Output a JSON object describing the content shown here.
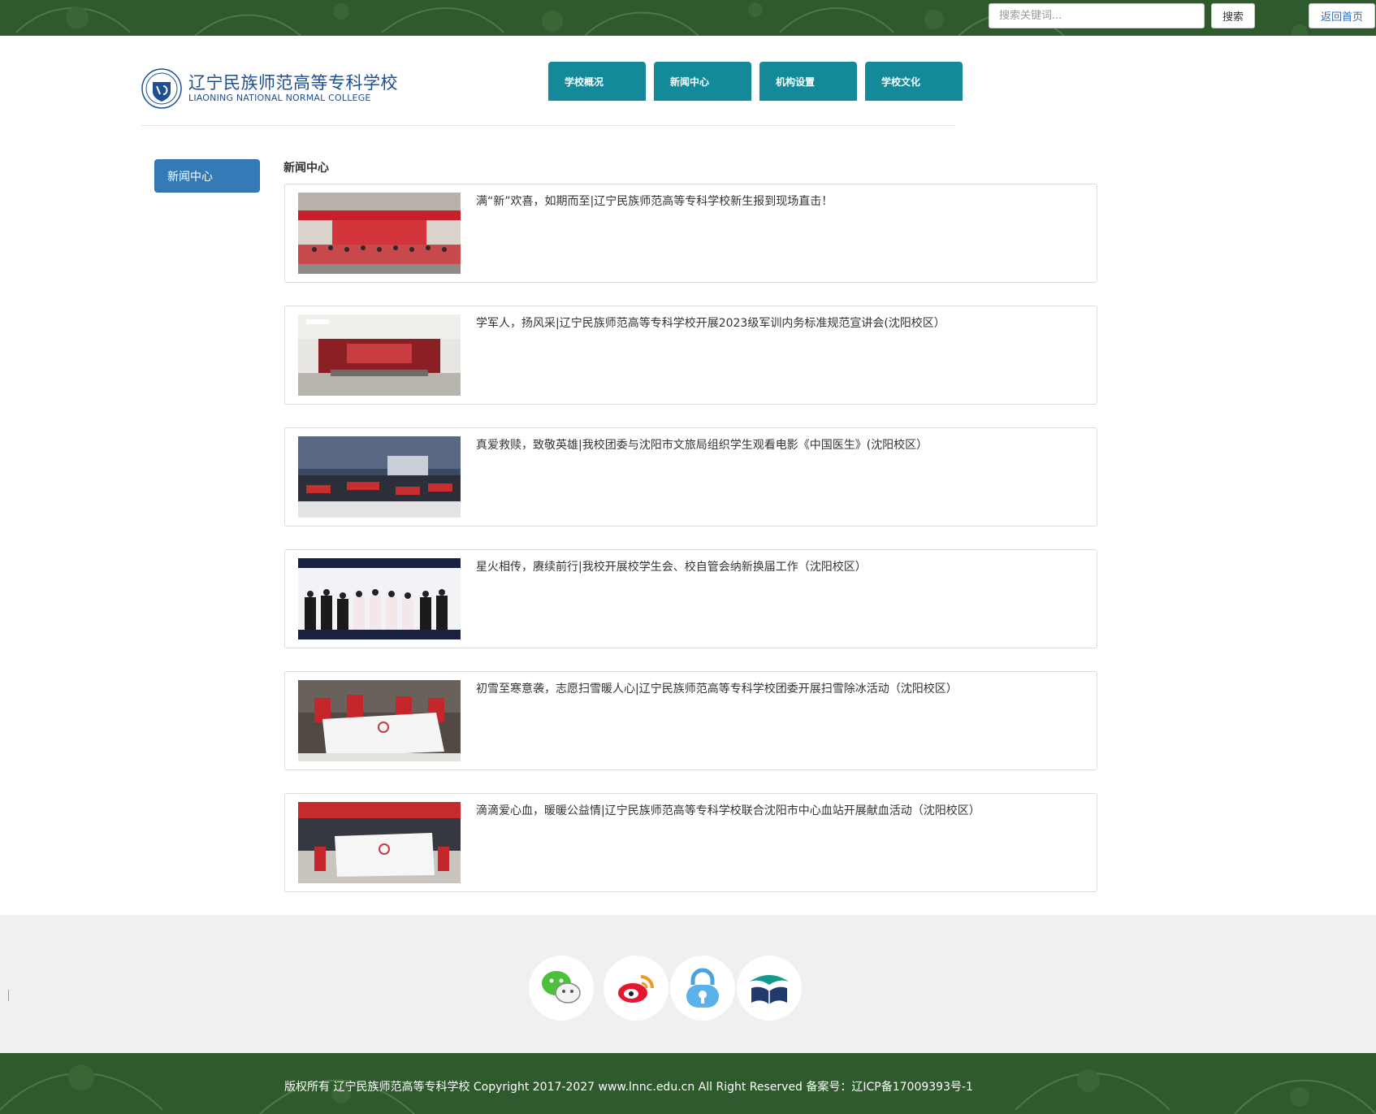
{
  "colors": {
    "topbar_green": "#2f5a2d",
    "nav_teal": "#13899a",
    "sidebar_blue": "#337ab7",
    "logo_blue": "#1d4f92"
  },
  "topbar": {
    "search_placeholder": "搜索关键词...",
    "search_button": "搜索",
    "home_link": "返回首页"
  },
  "logo": {
    "name_cn": "辽宁民族师范高等专科学校",
    "name_en": "LIAONING NATIONAL NORMAL COLLEGE"
  },
  "nav": [
    {
      "label": "学校概况"
    },
    {
      "label": "新闻中心"
    },
    {
      "label": "机构设置"
    },
    {
      "label": "学校文化"
    }
  ],
  "sidebar": {
    "items": [
      {
        "label": "新闻中心",
        "active": true
      }
    ]
  },
  "main": {
    "section_title": "新闻中心",
    "news": [
      {
        "title": "满“新”欢喜，如期而至|辽宁民族师范高等专科学校新生报到现场直击！",
        "thumb": "group-photo"
      },
      {
        "title": "学军人，扬风采|辽宁民族师范高等专科学校开展2023级军训内务标准规范宣讲会(沈阳校区）",
        "thumb": "stage-hall"
      },
      {
        "title": "真爱救赎，致敬英雄|我校团委与沈阳市文旅局组织学生观看电影《中国医生》(沈阳校区）",
        "thumb": "cinema-audience"
      },
      {
        "title": "星火相传，赓续前行|我校开展校学生会、校自管会纳新换届工作（沈阳校区）",
        "thumb": "stage-group"
      },
      {
        "title": "初雪至寒意袭，志愿扫雪暖人心|辽宁民族师范高等专科学校团委开展扫雪除冰活动（沈阳校区）",
        "thumb": "volunteer-banner"
      },
      {
        "title": "滴滴爱心血，暖暖公益情|辽宁民族师范高等专科学校联合沈阳市中心血站开展献血活动（沈阳校区）",
        "thumb": "blood-drive-banner"
      }
    ]
  },
  "footer": {
    "social": [
      {
        "icon": "wechat-icon"
      },
      {
        "icon": "weibo-icon"
      },
      {
        "icon": "lock-icon"
      },
      {
        "icon": "open-book-icon"
      }
    ],
    "copyright": "版权所有 辽宁民族师范高等专科学校 Copyright 2017-2027 www.lnnc.edu.cn All Right Reserved 备案号：辽ICP备17009393号-1"
  }
}
